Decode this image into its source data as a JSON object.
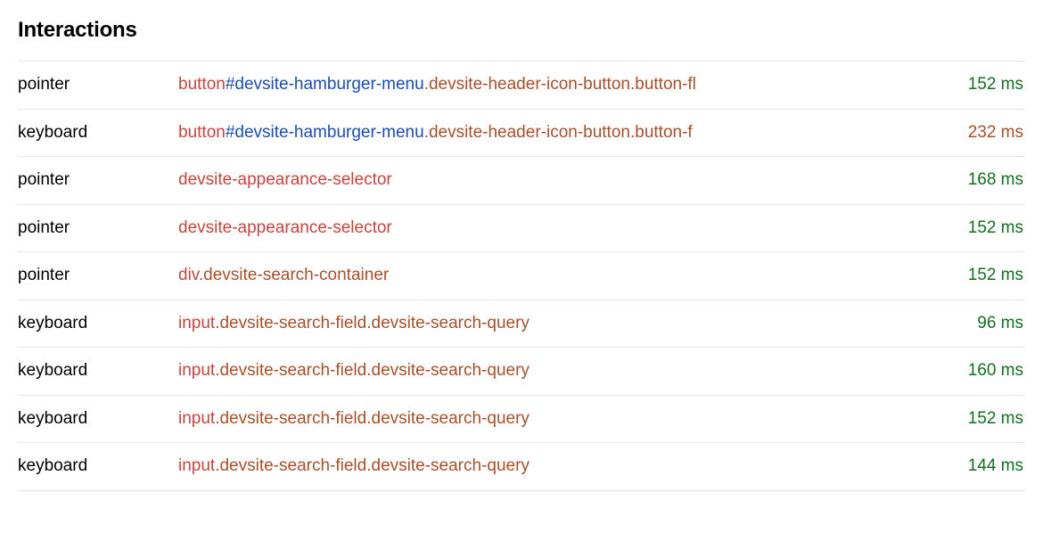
{
  "title": "Interactions",
  "rows": [
    {
      "type": "pointer",
      "element": {
        "tag": "button",
        "id": "#devsite-hamburger-menu",
        "cls": ".devsite-header-icon-button.button-fl"
      },
      "duration": "152 ms",
      "severity": "good"
    },
    {
      "type": "keyboard",
      "element": {
        "tag": "button",
        "id": "#devsite-hamburger-menu",
        "cls": ".devsite-header-icon-button.button-f"
      },
      "duration": "232 ms",
      "severity": "warn"
    },
    {
      "type": "pointer",
      "element": {
        "tag": "devsite-appearance-selector",
        "id": "",
        "cls": ""
      },
      "duration": "168 ms",
      "severity": "good"
    },
    {
      "type": "pointer",
      "element": {
        "tag": "devsite-appearance-selector",
        "id": "",
        "cls": ""
      },
      "duration": "152 ms",
      "severity": "good"
    },
    {
      "type": "pointer",
      "element": {
        "tag": "div",
        "id": "",
        "cls": ".devsite-search-container"
      },
      "duration": "152 ms",
      "severity": "good"
    },
    {
      "type": "keyboard",
      "element": {
        "tag": "input",
        "id": "",
        "cls": ".devsite-search-field.devsite-search-query"
      },
      "duration": "96 ms",
      "severity": "good"
    },
    {
      "type": "keyboard",
      "element": {
        "tag": "input",
        "id": "",
        "cls": ".devsite-search-field.devsite-search-query"
      },
      "duration": "160 ms",
      "severity": "good"
    },
    {
      "type": "keyboard",
      "element": {
        "tag": "input",
        "id": "",
        "cls": ".devsite-search-field.devsite-search-query"
      },
      "duration": "152 ms",
      "severity": "good"
    },
    {
      "type": "keyboard",
      "element": {
        "tag": "input",
        "id": "",
        "cls": ".devsite-search-field.devsite-search-query"
      },
      "duration": "144 ms",
      "severity": "good"
    }
  ]
}
